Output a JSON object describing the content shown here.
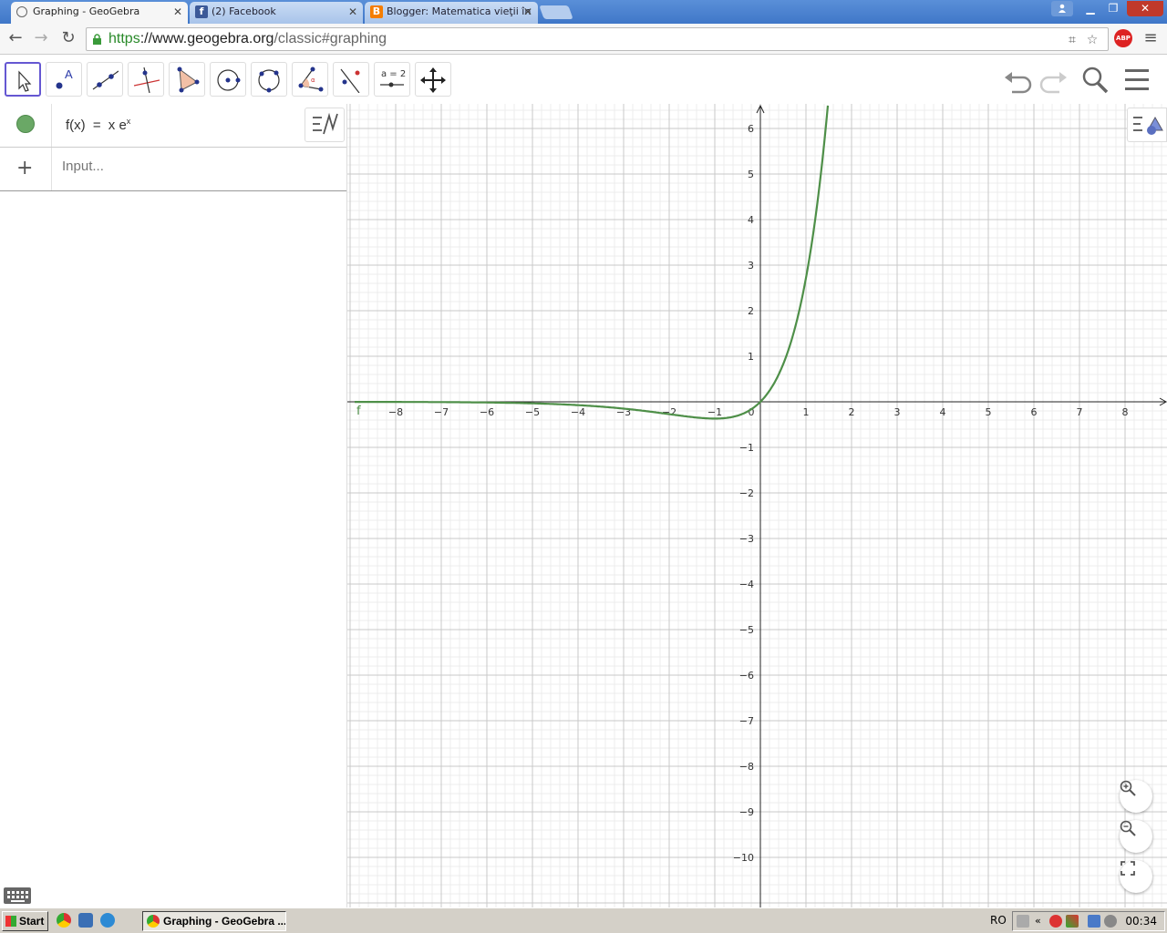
{
  "browser": {
    "tabs": [
      {
        "title": "Graphing - GeoGebra",
        "icon": "geogebra-icon",
        "active": true
      },
      {
        "title": "(2) Facebook",
        "icon": "facebook-icon",
        "active": false
      },
      {
        "title": "Blogger: Matematica vieţii în ",
        "icon": "blogger-icon",
        "active": false
      }
    ],
    "url_scheme": "https",
    "url_host": "://www.geogebra.org",
    "url_path": "/classic#graphing",
    "abp_label": "ABP"
  },
  "toolbar": {
    "tools": [
      "move-tool",
      "point-tool",
      "line-tool",
      "perpendicular-line-tool",
      "polygon-tool",
      "circle-center-point-tool",
      "circle-three-points-tool",
      "angle-tool",
      "reflect-about-line-tool",
      "slider-tool",
      "move-graphics-view-tool"
    ],
    "slider_label": "a = 2"
  },
  "algebra": {
    "entries": [
      {
        "lhs": "f(x)",
        "eq": "=",
        "rhs": "x e",
        "sup": "x",
        "color": "#6aa866"
      }
    ],
    "input_placeholder": "Input..."
  },
  "graphics": {
    "curve_label": "f",
    "curve_color": "#4e8f48",
    "x_ticks": [
      "−8",
      "−7",
      "−6",
      "−5",
      "−4",
      "−3",
      "−2",
      "−1",
      "0",
      "1",
      "2",
      "3",
      "4",
      "5",
      "6",
      "7",
      "8"
    ],
    "y_ticks_pos": [
      "1",
      "2",
      "3",
      "4",
      "5",
      "6"
    ],
    "y_ticks_neg": [
      "−1",
      "−2",
      "−3",
      "−4",
      "−5",
      "−6",
      "−7",
      "−8",
      "−9",
      "−10"
    ]
  },
  "chart_data": {
    "type": "line",
    "title": "",
    "xlabel": "",
    "ylabel": "",
    "xlim": [
      -8.9,
      9
    ],
    "ylim": [
      -11.1,
      6.5
    ],
    "grid": true,
    "series": [
      {
        "name": "f",
        "function": "x*exp(x)",
        "color": "#4e8f48",
        "x": [
          -8.9,
          -8,
          -7,
          -6,
          -5,
          -4,
          -3,
          -2,
          -1,
          -0.5,
          0,
          0.5,
          1,
          1.2,
          1.45
        ],
        "y": [
          -0.001,
          -0.003,
          -0.006,
          -0.015,
          -0.034,
          -0.073,
          -0.149,
          -0.271,
          -0.368,
          -0.303,
          0,
          0.824,
          2.718,
          3.984,
          6.18
        ]
      }
    ]
  },
  "taskbar": {
    "start_label": "Start",
    "task_label": "Graphing - GeoGebra ...",
    "language": "RO",
    "clock": "00:34"
  }
}
